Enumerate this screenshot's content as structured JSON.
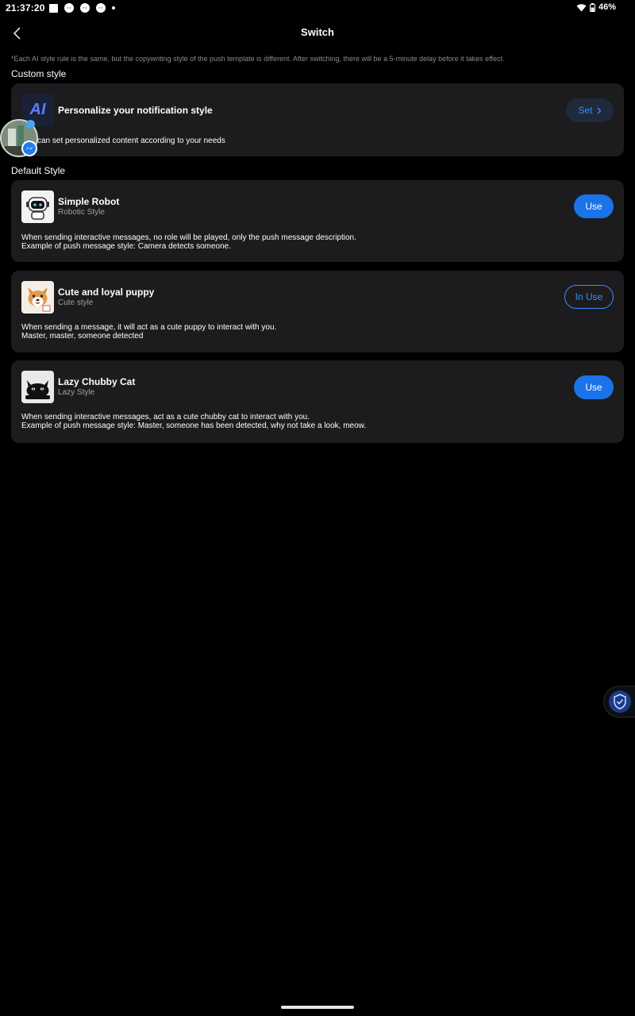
{
  "status_bar": {
    "time": "21:37:20",
    "battery": "46%"
  },
  "header": {
    "title": "Switch"
  },
  "note": "*Each AI style rule is the same, but the copywriting style of the push template is different. After switching, there will be a 5-minute delay before it takes effect.",
  "custom_section": {
    "label": "Custom style",
    "card": {
      "icon_text": "AI",
      "title": "Personalize your notification style",
      "button": "Set",
      "description": "can set personalized content according to your needs"
    }
  },
  "default_section": {
    "label": "Default Style",
    "styles": [
      {
        "title": "Simple Robot",
        "subtitle": "Robotic Style",
        "button": "Use",
        "desc_line1": "When sending interactive messages, no role will be played, only the push message description.",
        "desc_line2": "Example of push message style: Camera detects someone."
      },
      {
        "title": "Cute and loyal puppy",
        "subtitle": "Cute style",
        "button": "In Use",
        "desc_line1": "When sending a message, it will act as a cute puppy to interact with you.",
        "desc_line2": "Master, master, someone detected"
      },
      {
        "title": "Lazy Chubby Cat",
        "subtitle": "Lazy Style",
        "button": "Use",
        "desc_line1": "When sending interactive messages, act as a cute chubby cat to interact with you.",
        "desc_line2": "Example of push message style: Master, someone has been detected, why not take a look, meow."
      }
    ]
  },
  "colors": {
    "accent": "#1a73e8",
    "card_bg": "#1c1c1e",
    "page_bg": "#000000"
  }
}
